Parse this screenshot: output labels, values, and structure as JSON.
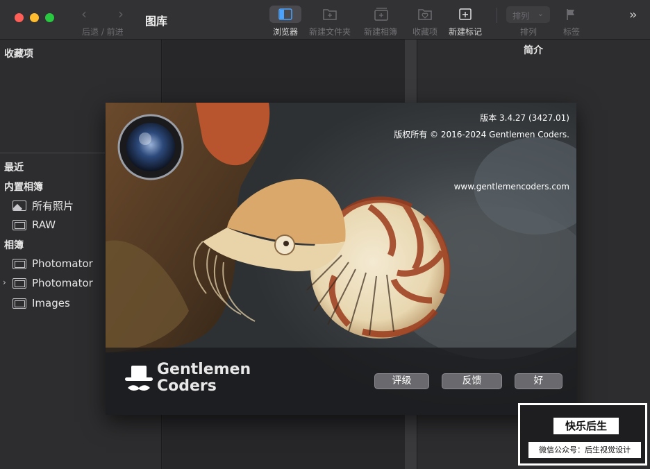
{
  "window": {
    "title": "图库"
  },
  "toolbar": {
    "nav_label": "后退 / 前进",
    "items": [
      {
        "label": "浏览器",
        "icon": "browser-icon",
        "active": true
      },
      {
        "label": "新建文件夹",
        "icon": "new-folder-icon",
        "active": false
      },
      {
        "label": "新建相簿",
        "icon": "new-album-icon",
        "active": false
      },
      {
        "label": "收藏项",
        "icon": "favorites-icon",
        "active": false
      },
      {
        "label": "新建标记",
        "icon": "new-marker-icon",
        "active": true
      }
    ],
    "sort_value": "排列",
    "sort_label": "排列",
    "tag_label": "标签"
  },
  "sidebar": {
    "favorites_header": "收藏项",
    "recent_header": "最近",
    "builtin_header": "内置相簿",
    "builtin_items": [
      {
        "label": "所有照片",
        "icon": "photos-icon"
      },
      {
        "label": "RAW",
        "icon": "folder-icon"
      }
    ],
    "albums_header": "相簿",
    "album_items": [
      {
        "label": "Photomator",
        "icon": "folder-icon"
      },
      {
        "label": "Photomator",
        "icon": "folder-icon"
      },
      {
        "label": "Images",
        "icon": "folder-icon"
      }
    ]
  },
  "info_pane": {
    "title": "简介"
  },
  "about": {
    "version": "版本 3.4.27 (3427.01)",
    "copyright": "版权所有 © 2016-2024 Gentlemen Coders.",
    "website": "www.gentlemencoders.com",
    "brand_line1": "Gentlemen",
    "brand_line2": "Coders",
    "buttons": {
      "rate": "评级",
      "feedback": "反馈",
      "ok": "好"
    }
  },
  "watermark": {
    "title": "快乐后生",
    "subtitle": "微信公众号：后生视觉设计"
  }
}
